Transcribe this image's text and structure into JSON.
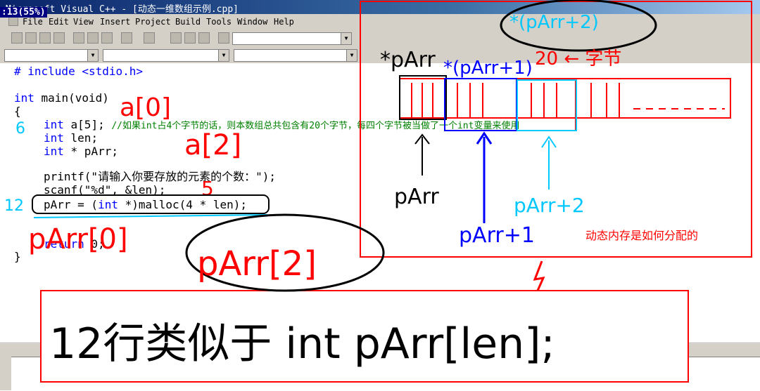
{
  "window": {
    "title": "Microsoft Visual C++ - [动态一维数组示例.cpp]",
    "timestamp": ":13(55%)"
  },
  "menu": {
    "items": [
      "File",
      "Edit",
      "View",
      "Insert",
      "Project",
      "Build",
      "Tools",
      "Window",
      "Help"
    ]
  },
  "code": {
    "line1": "# include <stdio.h>",
    "line3_kw": "int",
    "line3_rest": " main(void)",
    "line4": "{",
    "line5_kw": "int",
    "line5_decl": " a[5]; ",
    "line5_comment": "//如果int占4个字节的话，则本数组总共包含有20个字节，每四个字节被当做了一个int变量来使用",
    "line6_kw": "int",
    "line6_rest": " len;",
    "line7_kw": "int",
    "line7_rest": " * pArr;",
    "line9": "printf(\"请输入你要存放的元素的个数：\");",
    "line10": "scanf(\"%d\", &len);",
    "line11_a": "pArr = (",
    "line11_kw": "int",
    "line11_b": " *)malloc(4 * len);",
    "line12_kw": "return",
    "line12_rest": " 0;",
    "line13": "}"
  },
  "annotations": {
    "caption": "动态内存是如何分配的",
    "accent_red": "#ff0000",
    "accent_blue": "#0000ff",
    "accent_cyan": "#00c8ff"
  }
}
